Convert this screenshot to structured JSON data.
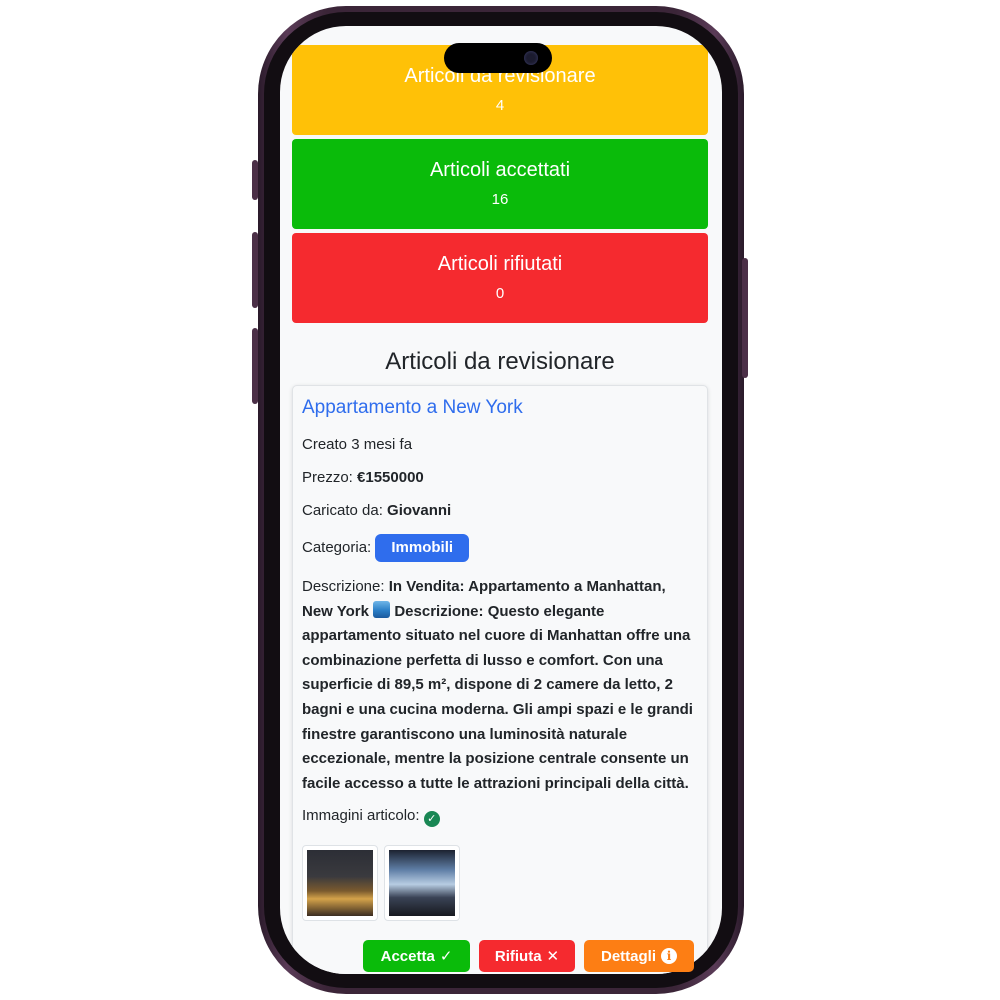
{
  "stats": [
    {
      "title": "Articoli da revisionare",
      "count": "4",
      "color": "#ffc107"
    },
    {
      "title": "Articoli accettati",
      "count": "16",
      "color": "#0abb0a"
    },
    {
      "title": "Articoli rifiutati",
      "count": "0",
      "color": "#f52a2f"
    }
  ],
  "section_title": "Articoli da revisionare",
  "article": {
    "title": "Appartamento a New York",
    "created": "Creato 3 mesi fa",
    "price_label": "Prezzo: ",
    "price_value": "€1550000",
    "uploader_label": "Caricato da: ",
    "uploader_value": "Giovanni",
    "category_label": "Categoria: ",
    "category_value": "Immobili",
    "description_label": "Descrizione: ",
    "description_part1": "In Vendita: Appartamento a Manhattan, New York",
    "description_part2": "Descrizione: Questo elegante appartamento situato nel cuore di Manhattan offre una combinazione perfetta di lusso e comfort. Con una superficie di 89,5 m², dispone di 2 camere da letto, 2 bagni e una cucina moderna. Gli ampi spazi e le grandi finestre garantiscono una luminosità naturale eccezionale, mentre la posizione centrale consente un facile accesso a tutte le attrazioni principali della città.",
    "images_label": "Immagini articolo: "
  },
  "actions": {
    "accept": "Accetta",
    "reject": "Rifiuta",
    "details": "Dettagli"
  },
  "colors": {
    "accent": "#2f6ded",
    "warning": "#ffc107",
    "success": "#0abb0a",
    "danger": "#f52a2f",
    "orange": "#fd7e14"
  }
}
